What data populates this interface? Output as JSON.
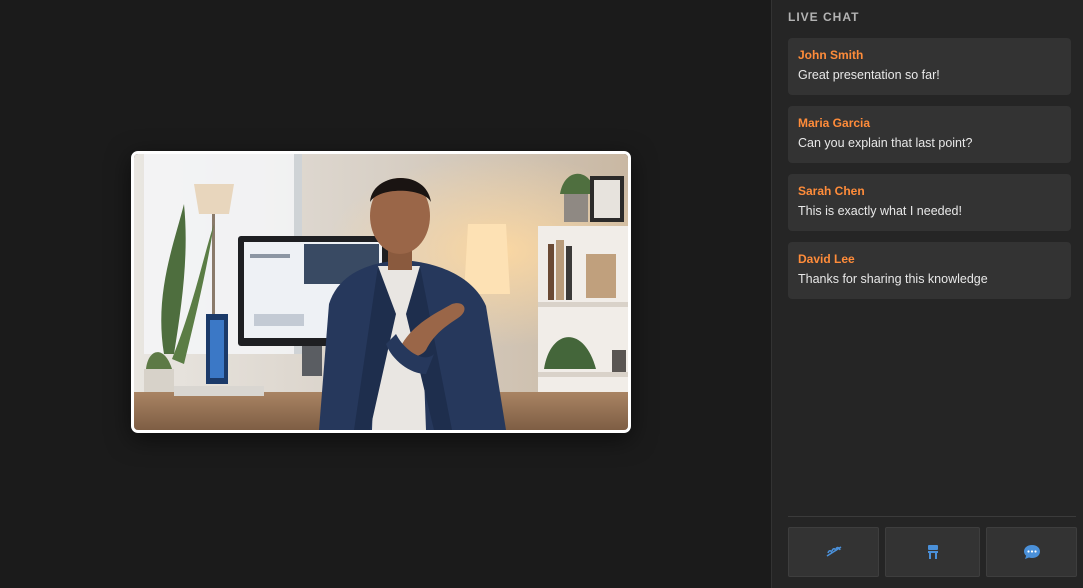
{
  "sidebar": {
    "title": "LIVE CHAT",
    "messages": [
      {
        "author": "John Smith",
        "text": "Great presentation so far!"
      },
      {
        "author": "Maria Garcia",
        "text": "Can you explain that last point?"
      },
      {
        "author": "Sarah Chen",
        "text": "This is exactly what I needed!"
      },
      {
        "author": "David Lee",
        "text": "Thanks for sharing this knowledge"
      }
    ]
  },
  "controls": {
    "buttons": [
      {
        "icon": "microphone-muted-icon"
      },
      {
        "icon": "seat-icon"
      },
      {
        "icon": "chat-bubble-icon"
      }
    ]
  },
  "colors": {
    "accent": "#ff8c3a",
    "background": "#1b1b1b",
    "sidebar": "#252525",
    "message_bg": "#333333",
    "icon_blue": "#4a90d9"
  }
}
